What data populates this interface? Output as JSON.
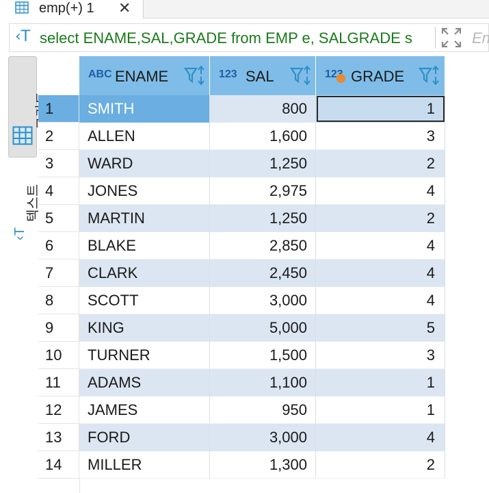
{
  "tab": {
    "title": "emp(+) 1",
    "close_glyph": "✕",
    "icon": "table-grid-icon"
  },
  "query": {
    "icon": "sql-text-icon",
    "text": "select ENAME,SAL,GRADE from EMP e, SALGRADE s",
    "hint": "En"
  },
  "side": {
    "grid_label": "그리드",
    "text_label": "텍스트"
  },
  "columns": [
    {
      "type": "ABC",
      "name": "ENAME"
    },
    {
      "type": "123",
      "name": "SAL"
    },
    {
      "type": "123",
      "name": "GRADE"
    }
  ],
  "rows": [
    {
      "num": "1",
      "ename": "SMITH",
      "sal": "800",
      "grade": "1"
    },
    {
      "num": "2",
      "ename": "ALLEN",
      "sal": "1,600",
      "grade": "3"
    },
    {
      "num": "3",
      "ename": "WARD",
      "sal": "1,250",
      "grade": "2"
    },
    {
      "num": "4",
      "ename": "JONES",
      "sal": "2,975",
      "grade": "4"
    },
    {
      "num": "5",
      "ename": "MARTIN",
      "sal": "1,250",
      "grade": "2"
    },
    {
      "num": "6",
      "ename": "BLAKE",
      "sal": "2,850",
      "grade": "4"
    },
    {
      "num": "7",
      "ename": "CLARK",
      "sal": "2,450",
      "grade": "4"
    },
    {
      "num": "8",
      "ename": "SCOTT",
      "sal": "3,000",
      "grade": "4"
    },
    {
      "num": "9",
      "ename": "KING",
      "sal": "5,000",
      "grade": "5"
    },
    {
      "num": "10",
      "ename": "TURNER",
      "sal": "1,500",
      "grade": "3"
    },
    {
      "num": "11",
      "ename": "ADAMS",
      "sal": "1,100",
      "grade": "1"
    },
    {
      "num": "12",
      "ename": "JAMES",
      "sal": "950",
      "grade": "1"
    },
    {
      "num": "13",
      "ename": "FORD",
      "sal": "3,000",
      "grade": "4"
    },
    {
      "num": "14",
      "ename": "MILLER",
      "sal": "1,300",
      "grade": "2"
    }
  ],
  "colors": {
    "header_bg": "#7fbde8",
    "row_alt_bg": "#dce6f2",
    "selected_bg": "#6aaee2",
    "query_text": "#1a7a1a",
    "accent_icon": "#2f8fc8"
  }
}
